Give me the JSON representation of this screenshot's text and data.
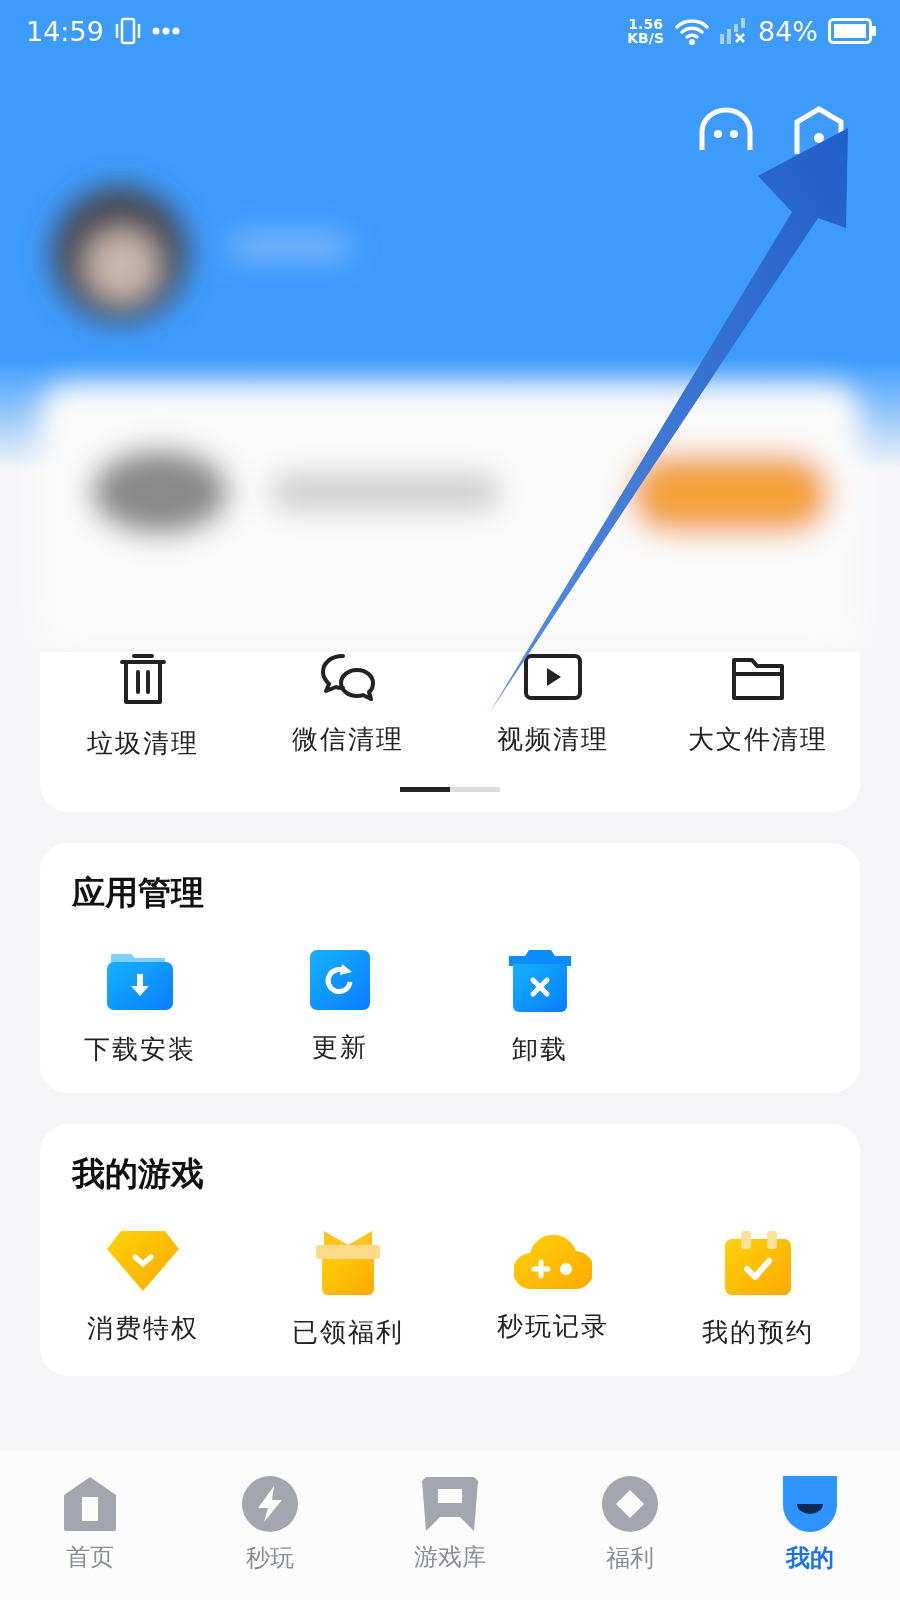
{
  "status_bar": {
    "time": "14:59",
    "net_speed_value": "1.56",
    "net_speed_unit": "KB/S",
    "battery": "84%"
  },
  "cleanup": {
    "items": [
      {
        "kind": "trash",
        "label": "垃圾清理"
      },
      {
        "kind": "chat",
        "label": "微信清理"
      },
      {
        "kind": "video",
        "label": "视频清理"
      },
      {
        "kind": "folder",
        "label": "大文件清理"
      }
    ]
  },
  "app_management": {
    "title": "应用管理",
    "items": [
      {
        "kind": "download",
        "label": "下载安装"
      },
      {
        "kind": "update",
        "label": "更新"
      },
      {
        "kind": "uninstall",
        "label": "卸载"
      }
    ]
  },
  "my_games": {
    "title": "我的游戏",
    "items": [
      {
        "kind": "privilege",
        "label": "消费特权"
      },
      {
        "kind": "gift",
        "label": "已领福利"
      },
      {
        "kind": "cloud",
        "label": "秒玩记录"
      },
      {
        "kind": "calendar",
        "label": "我的预约"
      }
    ]
  },
  "bottom_nav": [
    {
      "kind": "home",
      "label": "首页",
      "selected": false
    },
    {
      "kind": "bolt",
      "label": "秒玩",
      "selected": false
    },
    {
      "kind": "library",
      "label": "游戏库",
      "selected": false
    },
    {
      "kind": "welfare",
      "label": "福利",
      "selected": false
    },
    {
      "kind": "me",
      "label": "我的",
      "selected": true
    }
  ]
}
